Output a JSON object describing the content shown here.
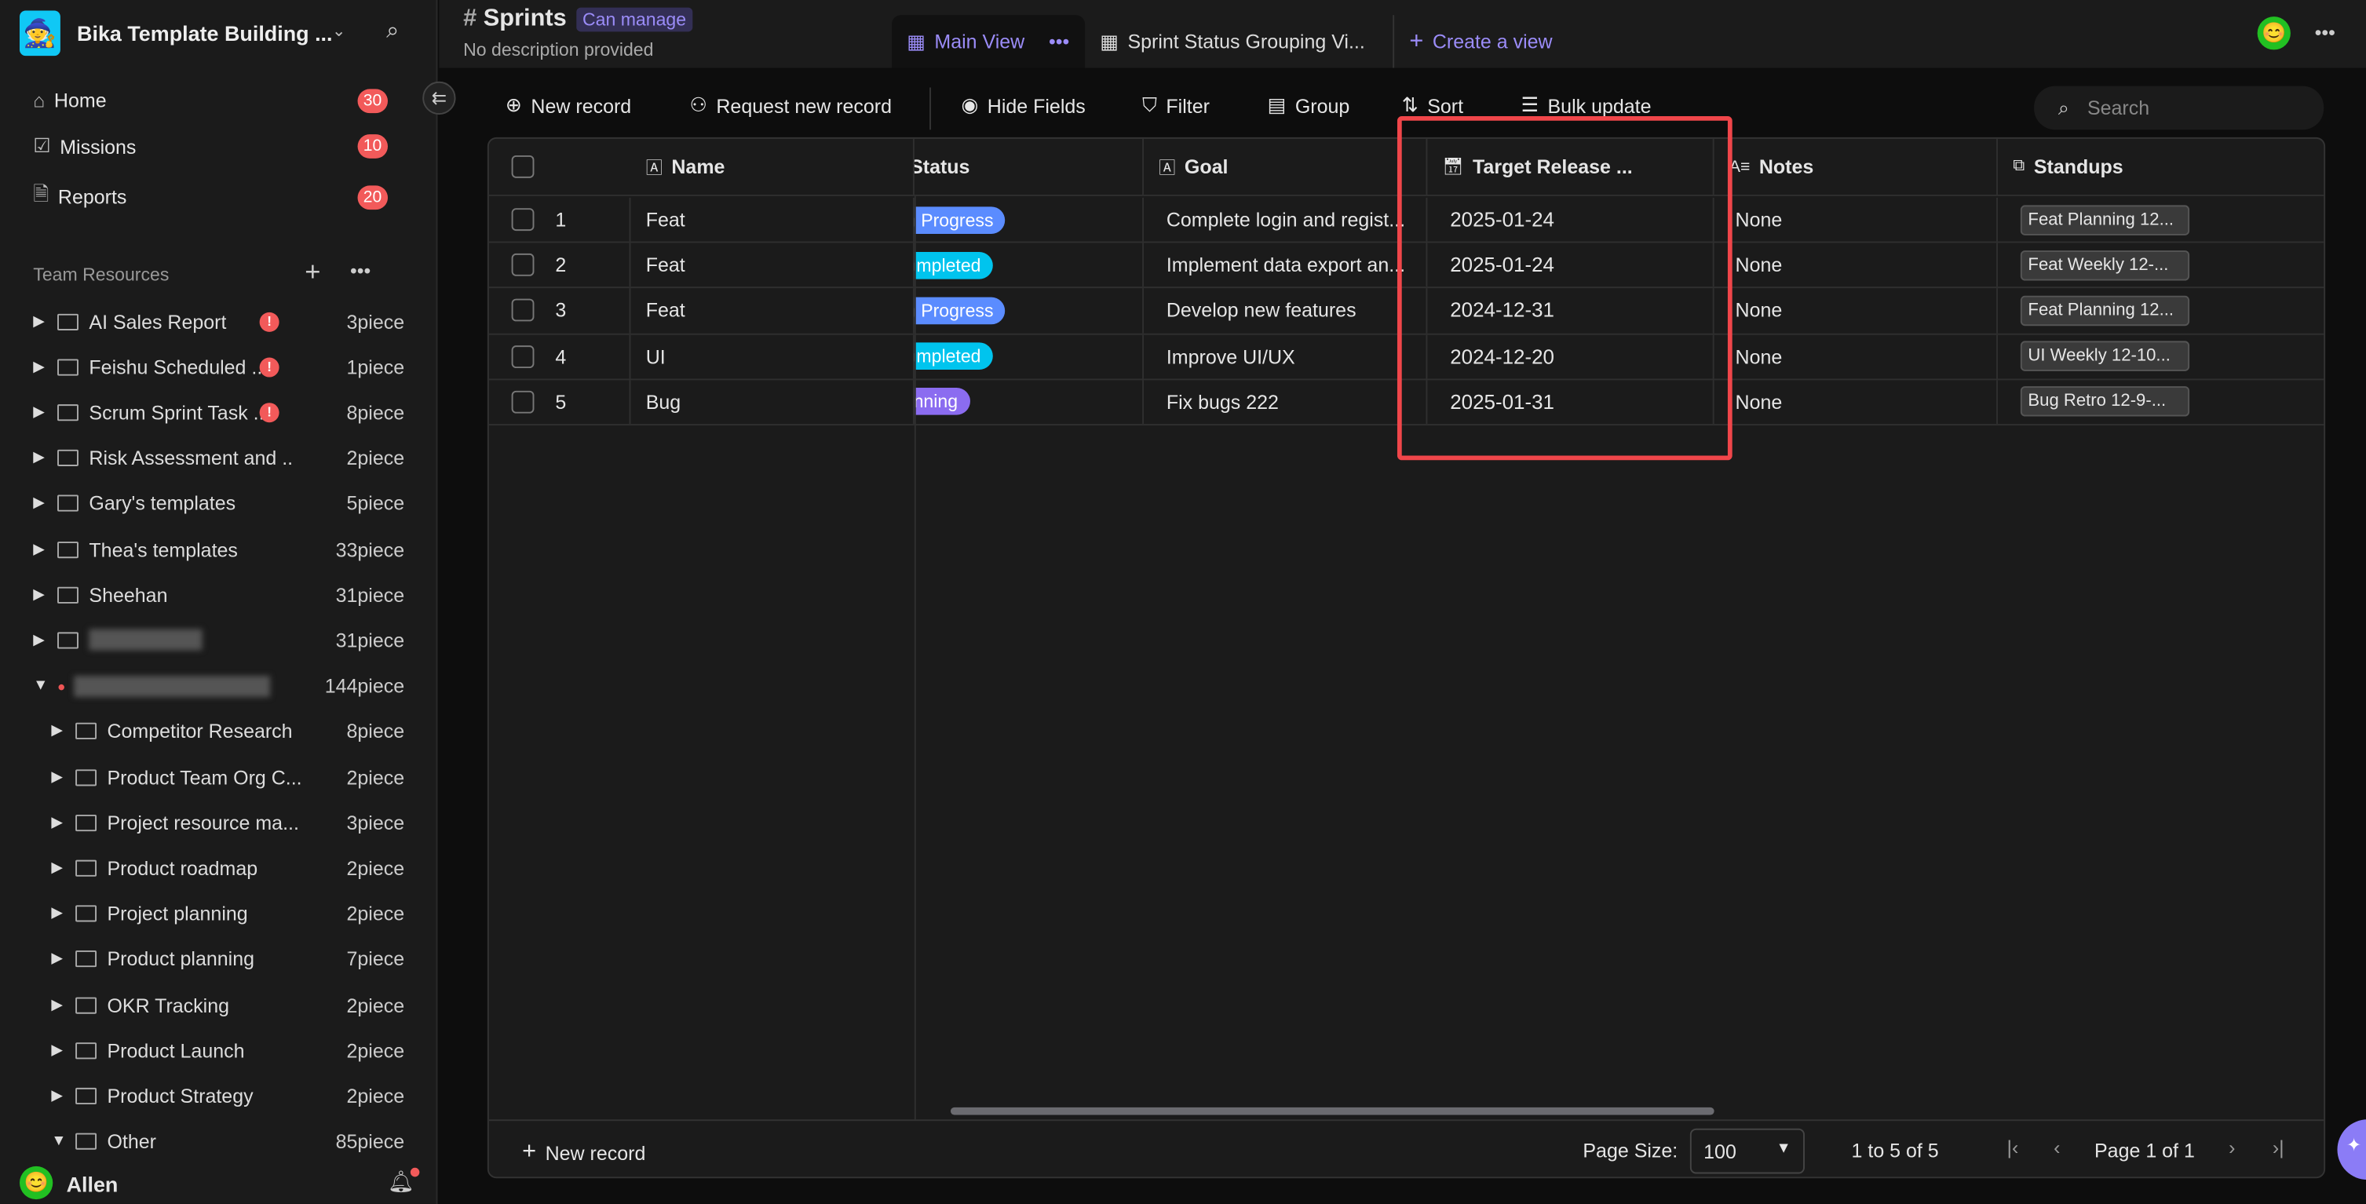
{
  "workspace": {
    "name": "Bika Template Building ...",
    "logo_icon": "wizard-emoji"
  },
  "nav": [
    {
      "label": "Home",
      "badge": "30"
    },
    {
      "label": "Missions",
      "badge": "10"
    },
    {
      "label": "Reports",
      "badge": "20"
    }
  ],
  "team_resources": {
    "title": "Team Resources",
    "items": [
      {
        "label": "AI Sales Report",
        "count": "3piece",
        "warn": true,
        "level": 0,
        "open": false
      },
      {
        "label": "Feishu Scheduled ...",
        "count": "1piece",
        "warn": true,
        "level": 0,
        "open": false
      },
      {
        "label": "Scrum Sprint Task ...",
        "count": "8piece",
        "warn": true,
        "level": 0,
        "open": false
      },
      {
        "label": "Risk Assessment and ...",
        "count": "2piece",
        "level": 0,
        "open": false
      },
      {
        "label": "Gary's templates",
        "count": "5piece",
        "level": 0,
        "open": false
      },
      {
        "label": "Thea's templates",
        "count": "33piece",
        "level": 0,
        "open": false
      },
      {
        "label": "Sheehan",
        "count": "31piece",
        "level": 0,
        "open": false
      },
      {
        "label": "",
        "count": "31piece",
        "level": 0,
        "open": false,
        "blurred": true
      },
      {
        "label": "",
        "count": "144piece",
        "level": 0,
        "open": true,
        "blurred": true
      },
      {
        "label": "Competitor Research",
        "count": "8piece",
        "level": 1,
        "open": false
      },
      {
        "label": "Product Team Org C...",
        "count": "2piece",
        "level": 1,
        "open": false
      },
      {
        "label": "Project resource ma...",
        "count": "3piece",
        "level": 1,
        "open": false
      },
      {
        "label": "Product roadmap",
        "count": "2piece",
        "level": 1,
        "open": false
      },
      {
        "label": "Project planning",
        "count": "2piece",
        "level": 1,
        "open": false
      },
      {
        "label": "Product planning",
        "count": "7piece",
        "level": 1,
        "open": false
      },
      {
        "label": "OKR Tracking",
        "count": "2piece",
        "level": 1,
        "open": false
      },
      {
        "label": "Product Launch",
        "count": "2piece",
        "level": 1,
        "open": false
      },
      {
        "label": "Product Strategy",
        "count": "2piece",
        "level": 1,
        "open": false
      },
      {
        "label": "Other",
        "count": "85piece",
        "level": 1,
        "open": true
      }
    ]
  },
  "user": {
    "name": "Allen"
  },
  "header": {
    "title": "Sprints",
    "permission": "Can manage",
    "description": "No description provided"
  },
  "views": [
    {
      "label": "Main View",
      "active": true
    },
    {
      "label": "Sprint Status Grouping Vi..."
    }
  ],
  "create_view": "Create a view",
  "toolbar": {
    "new_record": "New record",
    "request": "Request new record",
    "hide": "Hide Fields",
    "filter": "Filter",
    "group": "Group",
    "sort": "Sort",
    "bulk": "Bulk update",
    "search_placeholder": "Search"
  },
  "columns": [
    "Name",
    "Status",
    "Goal",
    "Target Release ...",
    "Notes",
    "Standups"
  ],
  "rows": [
    {
      "n": "1",
      "name": "Feat",
      "status": "In Progress",
      "status_color": "#5b8cff",
      "goal": "Complete login and regist...",
      "date": "2025-01-24",
      "notes": "None",
      "standup": "Feat Planning 12..."
    },
    {
      "n": "2",
      "name": "Feat",
      "status": "Completed",
      "status_color": "#00c4ee",
      "goal": "Implement data export an...",
      "date": "2025-01-24",
      "notes": "None",
      "standup": "Feat Weekly 12-..."
    },
    {
      "n": "3",
      "name": "Feat",
      "status": "In Progress",
      "status_color": "#5b8cff",
      "goal": "Develop new features",
      "date": "2024-12-31",
      "notes": "None",
      "standup": "Feat Planning 12..."
    },
    {
      "n": "4",
      "name": "UI",
      "status": "Completed",
      "status_color": "#00c4ee",
      "goal": "Improve UI/UX",
      "date": "2024-12-20",
      "notes": "None",
      "standup": "UI Weekly 12-10..."
    },
    {
      "n": "5",
      "name": "Bug",
      "status": "Planning",
      "status_color": "#8b6cf0",
      "goal": "Fix bugs 222",
      "date": "2025-01-31",
      "notes": "None",
      "standup": "Bug Retro 12-9-..."
    }
  ],
  "footer": {
    "new_record": "New record",
    "page_size_label": "Page Size:",
    "page_size": "100",
    "range": "1 to 5 of 5",
    "page": "Page 1 of 1"
  },
  "colors": {
    "accent": "#8b7cf6",
    "highlight": "#f0464a"
  }
}
